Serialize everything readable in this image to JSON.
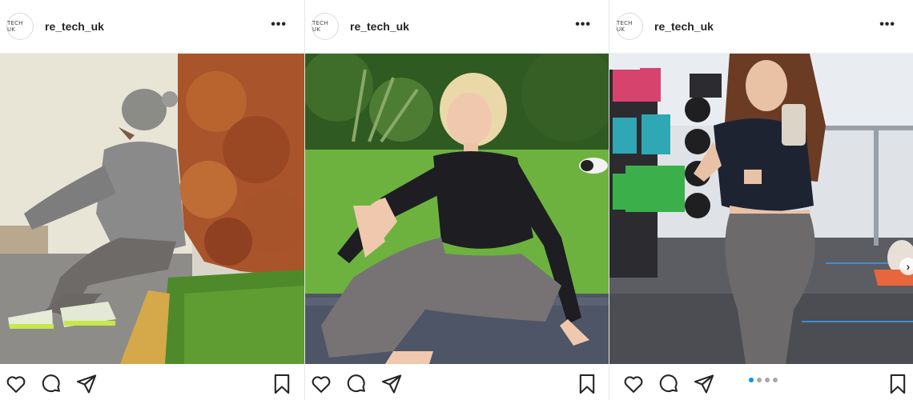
{
  "posts": [
    {
      "avatar_text": "TECH UK",
      "username": "re_tech_uk",
      "more": "•••",
      "has_carousel": false
    },
    {
      "avatar_text": "TECH UK",
      "username": "re_tech_uk",
      "more": "•••",
      "has_carousel": false
    },
    {
      "avatar_text": "TECH UK",
      "username": "re_tech_uk",
      "more": "•••",
      "has_carousel": true,
      "carousel": {
        "total": 4,
        "active_index": 0
      }
    }
  ],
  "icons": [
    "heart-icon",
    "comment-icon",
    "share-icon",
    "bookmark-icon",
    "more-icon",
    "chevron-right-icon"
  ],
  "colors": {
    "accent": "#0095f6",
    "text": "#262626",
    "border": "#dbdbdb"
  }
}
